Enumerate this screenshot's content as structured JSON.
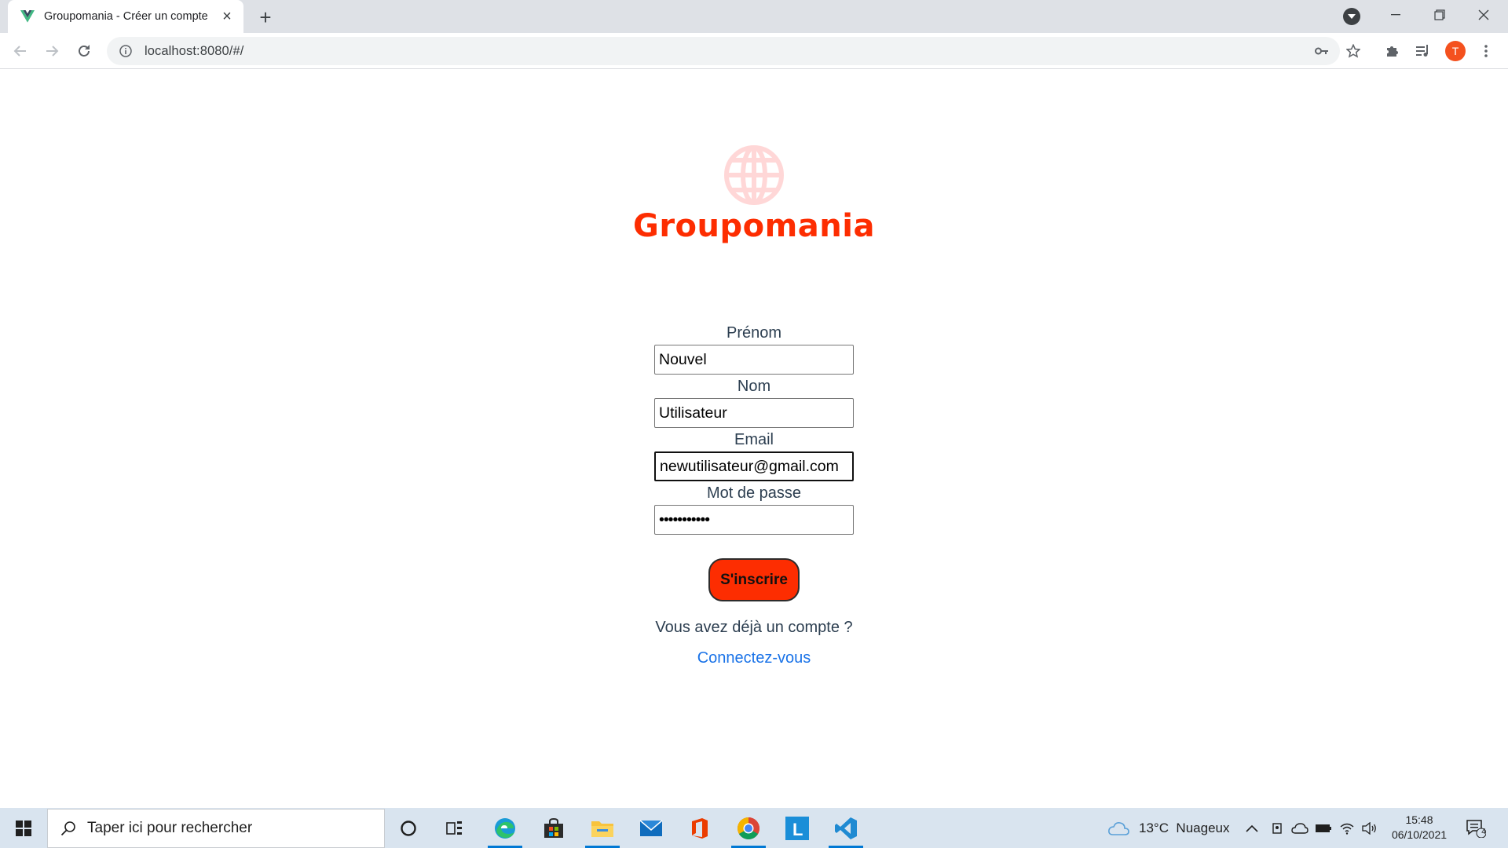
{
  "browser": {
    "tab_title": "Groupomania - Créer un compte",
    "url": "localhost:8080/#/",
    "profile_initial": "T"
  },
  "page": {
    "brand": "Groupomania",
    "fields": [
      {
        "label": "Prénom",
        "value": "Nouvel",
        "type": "text"
      },
      {
        "label": "Nom",
        "value": "Utilisateur",
        "type": "text"
      },
      {
        "label": "Email",
        "value": "newutilisateur@gmail.com",
        "type": "email"
      },
      {
        "label": "Mot de passe",
        "value": "•••••••••••",
        "type": "password"
      }
    ],
    "submit_label": "S'inscrire",
    "have_account_text": "Vous avez déjà un compte ?",
    "login_link": "Connectez-vous"
  },
  "taskbar": {
    "search_placeholder": "Taper ici pour rechercher",
    "weather": "13°C  Nuageux",
    "time": "15:48",
    "date": "06/10/2021",
    "notification_count": "4"
  },
  "colors": {
    "brand": "#fd2d01",
    "logo_light": "#ffd7d7",
    "link": "#1a73e8",
    "text": "#2c3e50"
  }
}
